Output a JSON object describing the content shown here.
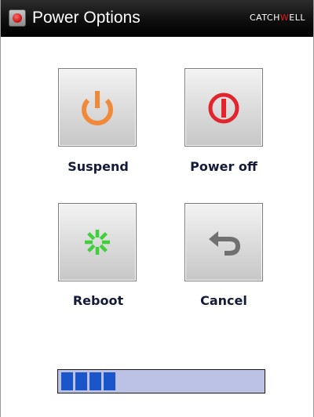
{
  "window": {
    "title": "Power Options",
    "brand_left": "CATCH",
    "brand_accent": "W",
    "brand_right": "ELL",
    "icon": "power-app-icon"
  },
  "options": [
    {
      "id": "suspend",
      "label": "Suspend",
      "icon": "suspend-power-icon",
      "color": "#f08a3a"
    },
    {
      "id": "poweroff",
      "label": "Power off",
      "icon": "power-off-icon",
      "color": "#e2242c"
    },
    {
      "id": "reboot",
      "label": "Reboot",
      "icon": "reboot-spinner-icon",
      "color": "#3fcf3a"
    },
    {
      "id": "cancel",
      "label": "Cancel",
      "icon": "undo-arrow-icon",
      "color": "#707070"
    }
  ],
  "progress": {
    "segments_filled": 4,
    "fraction": 0.3,
    "fill_color": "#1a56c9",
    "track_color": "#bcc2e6"
  }
}
